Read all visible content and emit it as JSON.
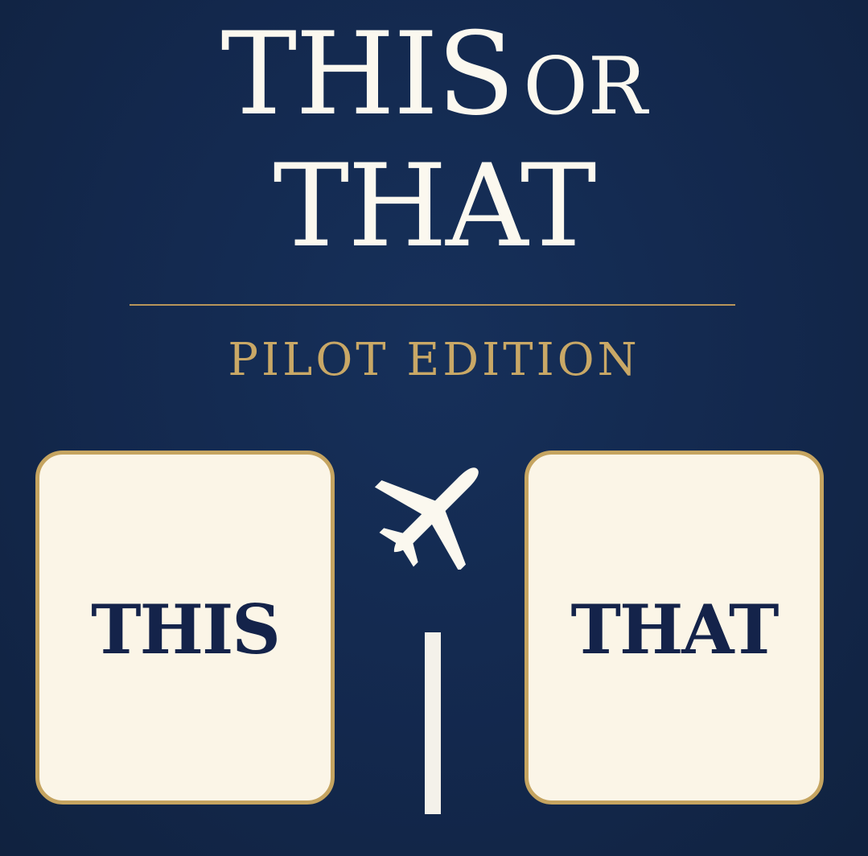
{
  "title": {
    "line1_main": "THIS",
    "line1_small": "OR",
    "line2": "THAT"
  },
  "subtitle": "PILOT EDITION",
  "options": {
    "this_label": "THIS",
    "that_label": "THAT"
  },
  "colors": {
    "background": "#13284d",
    "gold": "#c5a460",
    "card_fill": "#fbf5e7",
    "card_text": "#14234a",
    "title_text": "#fbf8ef"
  },
  "icons": {
    "divider_icon": "airplane-icon",
    "runway": "runway-line"
  }
}
